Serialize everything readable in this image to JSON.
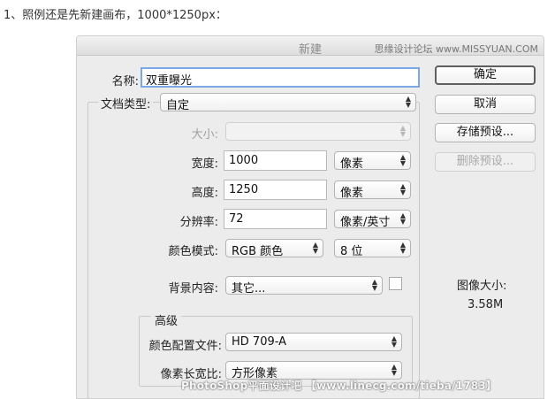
{
  "intro": "1、照例还是先新建画布，1000*1250px：",
  "dialog": {
    "title": "新建",
    "watermark_top": "思缘设计论坛 www.MISSYUAN.COM",
    "watermark_bottom": "PhotoShop平面设计吧 【www.linecg.com/tieba/1783】"
  },
  "fields": {
    "name_label": "名称:",
    "name_value": "双重曝光",
    "doc_type_label": "文档类型:",
    "doc_type_value": "自定",
    "size_label": "大小:",
    "size_value": "",
    "width_label": "宽度:",
    "width_value": "1000",
    "width_unit": "像素",
    "height_label": "高度:",
    "height_value": "1250",
    "height_unit": "像素",
    "resolution_label": "分辨率:",
    "resolution_value": "72",
    "resolution_unit": "像素/英寸",
    "color_mode_label": "颜色模式:",
    "color_mode_value": "RGB 颜色",
    "bit_depth_value": "8 位",
    "background_label": "背景内容:",
    "background_value": "其它..."
  },
  "advanced": {
    "title": "高级",
    "color_profile_label": "颜色配置文件:",
    "color_profile_value": "HD 709-A",
    "pixel_aspect_label": "像素长宽比:",
    "pixel_aspect_value": "方形像素"
  },
  "buttons": {
    "ok": "确定",
    "cancel": "取消",
    "save_preset": "存储预设...",
    "delete_preset": "删除预设..."
  },
  "image_size": {
    "label": "图像大小:",
    "value": "3.58M"
  }
}
